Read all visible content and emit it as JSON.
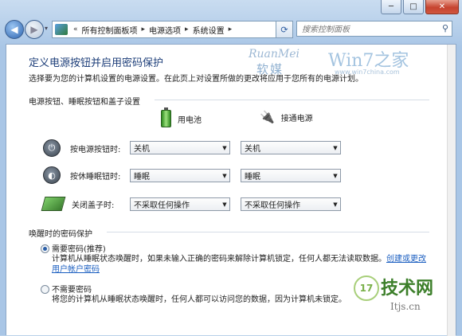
{
  "window": {
    "minimize_label": "─",
    "maximize_label": "□",
    "close_label": "✕"
  },
  "navbar": {
    "breadcrumb_prefix": "«",
    "crumbs": [
      "所有控制面板项",
      "电源选项",
      "系统设置"
    ],
    "crumb_sep": "▸",
    "search_placeholder": "搜索控制面板"
  },
  "brand": {
    "ruanmei": "RuanMei",
    "ruanmei_cn": "软媒",
    "win7": "Win7之家",
    "url": "www.win7china.com"
  },
  "page": {
    "title": "定义电源按钮并启用密码保护",
    "subtitle": "选择要为您的计算机设置的电源设置。在此页上对设置所做的更改将应用于您所有的电源计划。"
  },
  "section_power": {
    "heading": "电源按钮、睡眠按钮和盖子设置",
    "col_battery": "用电池",
    "col_plugged": "接通电源",
    "rows": [
      {
        "label": "按电源按钮时:",
        "battery": "关机",
        "plugged": "关机"
      },
      {
        "label": "按休睡眠钮时:",
        "battery": "睡眠",
        "plugged": "睡眠"
      },
      {
        "label": "关闭盖子时:",
        "battery": "不采取任何操作",
        "plugged": "不采取任何操作"
      }
    ]
  },
  "section_password": {
    "heading": "唤醒时的密码保护",
    "option_require": {
      "label": "需要密码(推荐)",
      "selected": true,
      "desc": "计算机从睡眠状态唤醒时，如果未输入正确的密码来解除计算机锁定，任何人都无法读取数据。",
      "link": "创建或更改用户帐户密码"
    },
    "option_none": {
      "label": "不需要密码",
      "selected": false,
      "desc": "将您的计算机从睡眠状态唤醒时，任何人都可以访问您的数据，因为计算机未锁定。"
    }
  },
  "watermark": {
    "badge": "17",
    "text": "技术网",
    "domain": "Itjs.cn"
  }
}
